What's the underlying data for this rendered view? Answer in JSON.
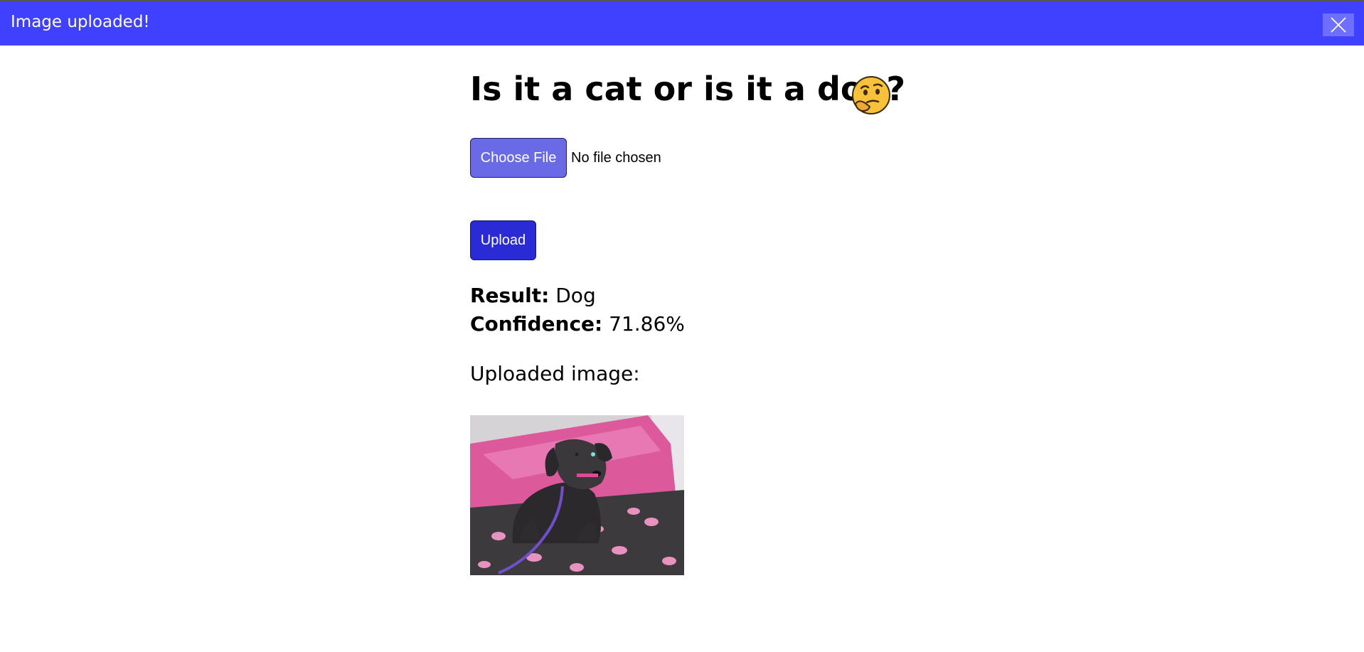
{
  "notification": {
    "message": "Image uploaded!",
    "close_icon": "close-icon"
  },
  "page": {
    "title": "Is it a cat or is it a dog?",
    "title_icon": "thinking-face-icon"
  },
  "file_input": {
    "button_label": "Choose File",
    "status_text": "No file chosen"
  },
  "upload": {
    "button_label": "Upload"
  },
  "result": {
    "result_label": "Result:",
    "result_value": "Dog",
    "confidence_label": "Confidence:",
    "confidence_value": "71.86%"
  },
  "uploaded": {
    "label": "Uploaded image:",
    "image_subject": "small black dog on pink pillow"
  },
  "colors": {
    "notification_bar": "#4040ff",
    "choose_file_button": "#6a6ae6",
    "upload_button": "#2b2bd6"
  }
}
